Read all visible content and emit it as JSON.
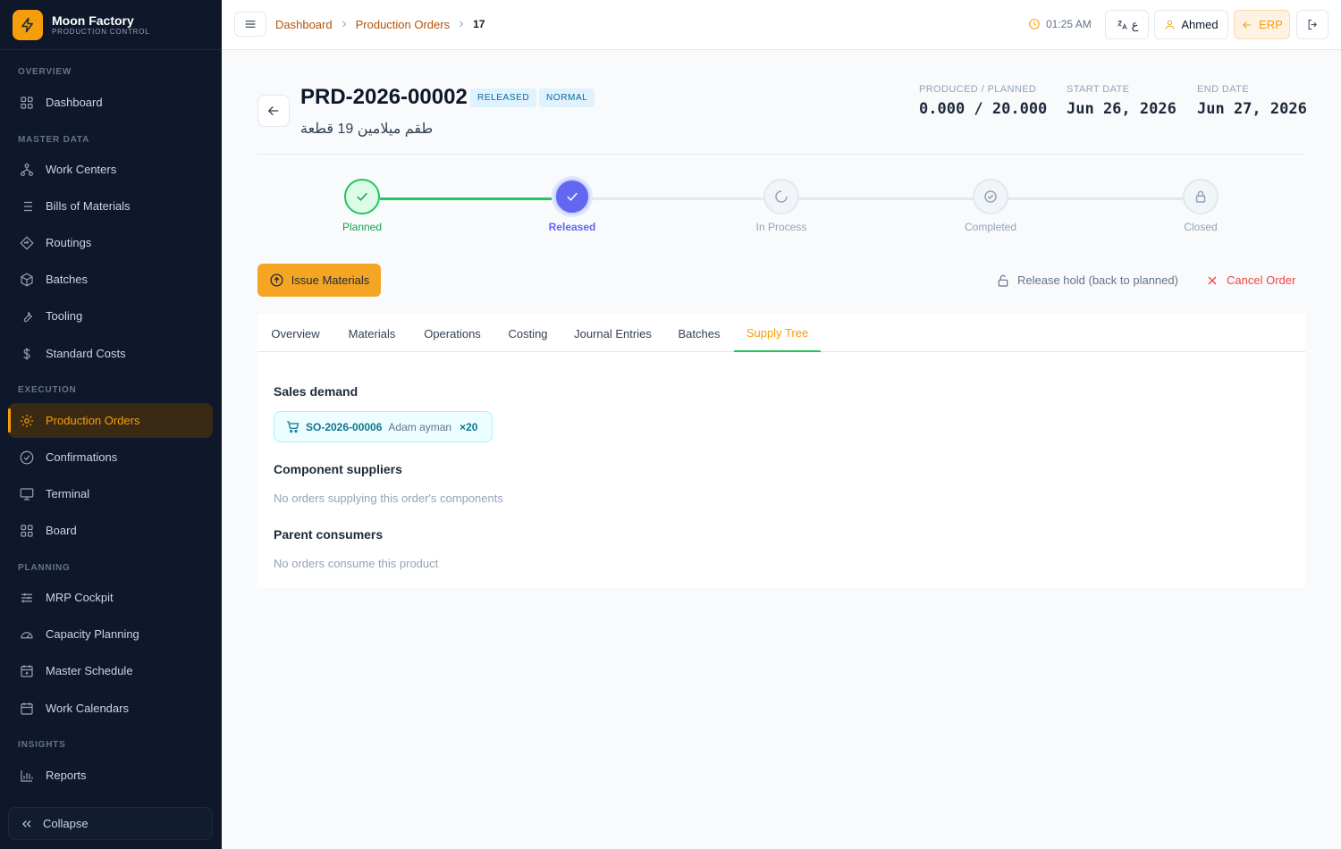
{
  "brand": {
    "name": "Moon Factory",
    "subtitle": "PRODUCTION CONTROL"
  },
  "sidebar": {
    "sections": [
      {
        "title": "OVERVIEW",
        "items": [
          {
            "label": "Dashboard",
            "icon": "grid-icon"
          }
        ]
      },
      {
        "title": "MASTER DATA",
        "items": [
          {
            "label": "Work Centers",
            "icon": "network-icon"
          },
          {
            "label": "Bills of Materials",
            "icon": "list-icon"
          },
          {
            "label": "Routings",
            "icon": "route-icon"
          },
          {
            "label": "Batches",
            "icon": "box-icon"
          },
          {
            "label": "Tooling",
            "icon": "wrench-icon"
          },
          {
            "label": "Standard Costs",
            "icon": "dollar-icon"
          }
        ]
      },
      {
        "title": "EXECUTION",
        "items": [
          {
            "label": "Production Orders",
            "icon": "gear-icon",
            "active": true
          },
          {
            "label": "Confirmations",
            "icon": "check-circle-icon"
          },
          {
            "label": "Terminal",
            "icon": "monitor-icon"
          },
          {
            "label": "Board",
            "icon": "board-icon"
          }
        ]
      },
      {
        "title": "PLANNING",
        "items": [
          {
            "label": "MRP Cockpit",
            "icon": "sliders-icon"
          },
          {
            "label": "Capacity Planning",
            "icon": "gauge-icon"
          },
          {
            "label": "Master Schedule",
            "icon": "calendar-icon"
          },
          {
            "label": "Work Calendars",
            "icon": "calendar-icon"
          }
        ]
      },
      {
        "title": "INSIGHTS",
        "items": [
          {
            "label": "Reports",
            "icon": "bar-chart-icon"
          }
        ]
      }
    ],
    "collapse_label": "Collapse"
  },
  "topbar": {
    "breadcrumbs": [
      "Dashboard",
      "Production Orders"
    ],
    "current": "17",
    "time": "01:25 AM",
    "lang_label": "ع",
    "user_name": "Ahmed",
    "erp_label": "ERP"
  },
  "order": {
    "number": "PRD-2026-00002",
    "status_badge": "RELEASED",
    "priority_badge": "NORMAL",
    "product_name": "طقم ميلامين 19 قطعة",
    "produced_label": "PRODUCED / PLANNED",
    "produced_value": "0.000 / 20.000",
    "start_label": "START DATE",
    "start_value": "Jun 26, 2026",
    "end_label": "END DATE",
    "end_value": "Jun 27, 2026"
  },
  "stepper": {
    "steps": [
      {
        "label": "Planned",
        "state": "completed",
        "icon": "check-icon"
      },
      {
        "label": "Released",
        "state": "current",
        "icon": "check-icon"
      },
      {
        "label": "In Process",
        "state": "pending",
        "icon": "spinner-icon"
      },
      {
        "label": "Completed",
        "state": "pending",
        "icon": "check-circle-icon"
      },
      {
        "label": "Closed",
        "state": "pending",
        "icon": "lock-icon"
      }
    ]
  },
  "actions": {
    "issue_label": "Issue Materials",
    "release_hold_label": "Release hold (back to planned)",
    "cancel_label": "Cancel Order"
  },
  "tabs": {
    "items": [
      "Overview",
      "Materials",
      "Operations",
      "Costing",
      "Journal Entries",
      "Batches",
      "Supply Tree"
    ],
    "active": "Supply Tree"
  },
  "supply_tree": {
    "sales_demand_title": "Sales demand",
    "demand": {
      "order_no": "SO-2026-00006",
      "customer": "Adam ayman",
      "qty": "×20"
    },
    "component_suppliers_title": "Component suppliers",
    "component_suppliers_empty": "No orders supplying this order's components",
    "parent_consumers_title": "Parent consumers",
    "parent_consumers_empty": "No orders consume this product"
  },
  "colors": {
    "accent": "#f59e0b",
    "sidebar_bg": "#0f172a",
    "success": "#22c55e",
    "current_step": "#6366f1",
    "danger": "#ef4444"
  }
}
